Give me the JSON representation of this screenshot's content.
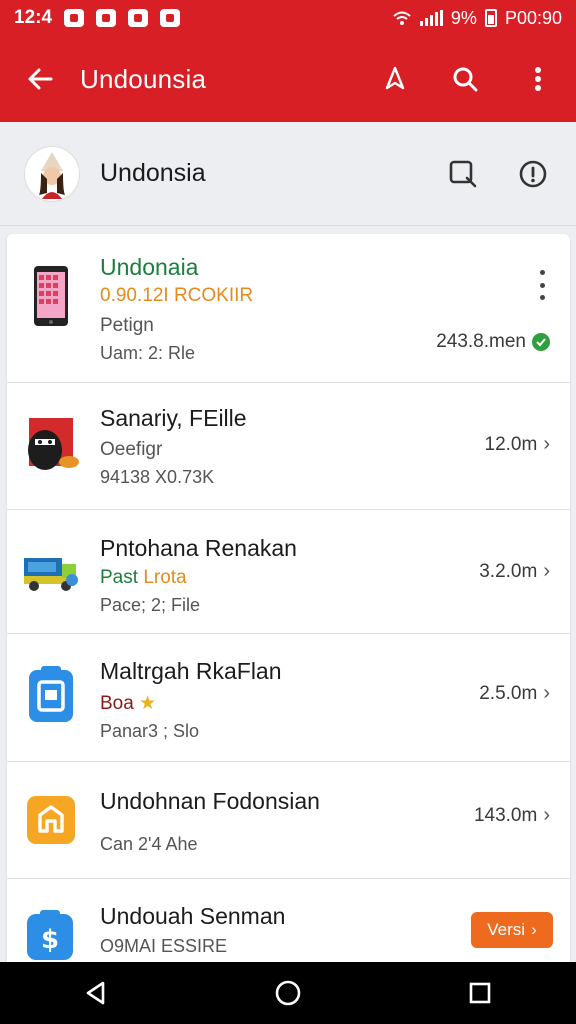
{
  "status_bar": {
    "time": "12:4",
    "battery": "9%",
    "clock_right": "P00:90"
  },
  "app_bar": {
    "title": "Undounsia"
  },
  "profile": {
    "name": "Undonsia"
  },
  "items": [
    {
      "title": "Undonaia",
      "subtitle": "0.90.12I RCOKIIR",
      "meta1": "Petign",
      "meta2": "Uam: 2: Rle",
      "size": "243.8.men",
      "status": "verified",
      "title_color": "#1a7f3c",
      "subtitle_color": "#e8891c"
    },
    {
      "title": "Sanariy, FEille",
      "subtitle": "Oeefigr",
      "meta2": "94138 X0.73K",
      "size": "12.0m"
    },
    {
      "title": "Pntohana Renakan",
      "subtitle_a": "Past",
      "subtitle_b": "Lrota",
      "meta2": "Pace; 2; File",
      "size": "3.2.0m",
      "subtitle_a_color": "#1a7f3c",
      "subtitle_b_color": "#e8891c"
    },
    {
      "title": "Maltrgah RkaFlan",
      "subtitle": "Boa",
      "meta2": "Panar3 ; Slo",
      "size": "2.5.0m",
      "subtitle_color": "#8a1a1a"
    },
    {
      "title": "Undohnan Fodonsian",
      "meta2": "Can 2'4 Ahe",
      "size": "143.0m"
    },
    {
      "title": "Undouah Senman",
      "meta2": "O9MAI ESSIRE",
      "button": "Versi"
    }
  ],
  "colors": {
    "primary": "#d81f26",
    "accent_orange": "#ee6a1f",
    "green": "#2e9e3f"
  },
  "icons": [
    "back-arrow-icon",
    "pin-icon",
    "search-icon",
    "more-icon",
    "square-search-icon",
    "info-icon",
    "phone-icon",
    "ninja-icon",
    "truck-icon",
    "app-blue-icon",
    "app-orange-icon",
    "dollar-icon",
    "back-nav-icon",
    "home-nav-icon",
    "recents-nav-icon"
  ]
}
